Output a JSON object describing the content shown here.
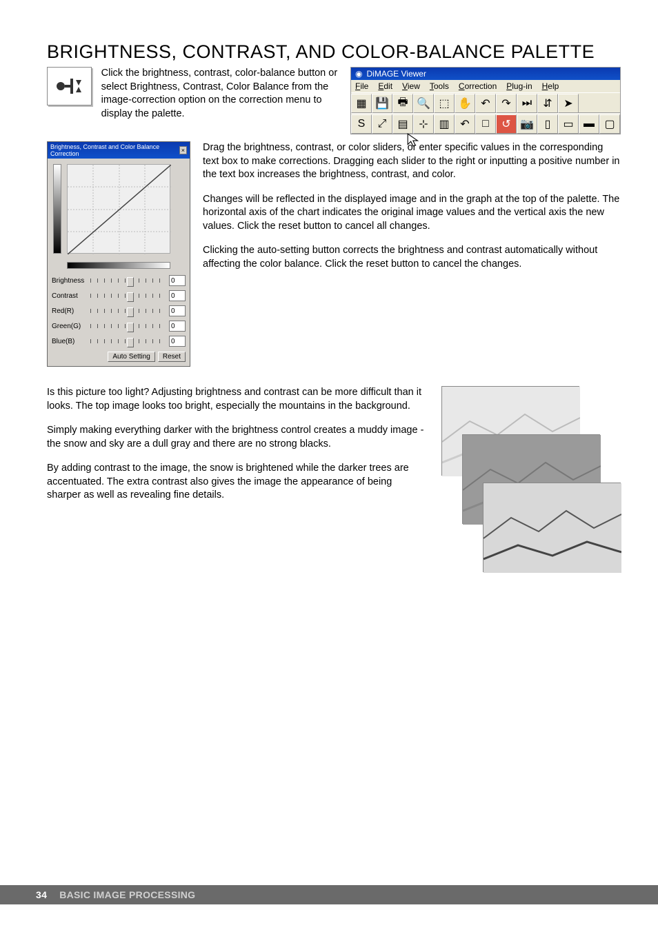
{
  "heading": "BRIGHTNESS, CONTRAST, AND COLOR-BALANCE PALETTE",
  "intro": "Click the brightness, contrast, color-balance button or select Brightness, Contrast, Color Balance from the image-correction option on the correction menu to display the palette.",
  "app": {
    "title": "DiMAGE Viewer",
    "menu": [
      "File",
      "Edit",
      "View",
      "Tools",
      "Correction",
      "Plug-in",
      "Help"
    ],
    "toolbar1_names": [
      "thumbnails-icon",
      "save-icon",
      "print-icon",
      "zoom-icon",
      "marquee-icon",
      "hand-icon",
      "rotate-left-icon",
      "rotate-right-icon",
      "skip-icon",
      "flip-icon",
      "arrow-icon"
    ],
    "toolbar1_glyphs": [
      "▦",
      "💾",
      "🖶",
      "🔍",
      "⬚",
      "✋",
      "↶",
      "↷",
      "⏭",
      "⇵",
      "➤"
    ],
    "toolbar2_names": [
      "sharpen-icon",
      "curve-icon",
      "contrast-icon",
      "sliders-icon",
      "variations-icon",
      "undo-icon",
      "redo-icon",
      "snapshot-active-icon",
      "camera-icon",
      "compare-a-icon",
      "compare-b-icon",
      "film-icon",
      "monitor-icon"
    ],
    "toolbar2_glyphs": [
      "S",
      "⤢",
      "▤",
      "⊹",
      "▥",
      "↶",
      "□",
      "↺",
      "📷",
      "▯",
      "▭",
      "▬",
      "▢"
    ]
  },
  "palette": {
    "title": "Brightness, Contrast and Color Balance Correction",
    "sliders": [
      {
        "label": "Brightness",
        "value": "0"
      },
      {
        "label": "Contrast",
        "value": "0"
      },
      {
        "label": "Red(R)",
        "value": "0"
      },
      {
        "label": "Green(G)",
        "value": "0"
      },
      {
        "label": "Blue(B)",
        "value": "0"
      }
    ],
    "auto": "Auto Setting",
    "reset": "Reset"
  },
  "body1": "Drag the brightness, contrast, or color sliders, or enter specific values in the corresponding text box to make corrections. Dragging each slider to the right or inputting a positive number in the text box increases the brightness, contrast, and color.",
  "body2": "Changes will be reflected in the displayed image and in the graph at the top of the palette. The horizontal axis of the chart indicates the original image values and the vertical axis the new values. Click the reset button to cancel all changes.",
  "body3": "Clicking the auto-setting button corrects the brightness and contrast automatically without affecting the color balance. Click the reset button to cancel the changes.",
  "lower1": "Is this picture too light? Adjusting brightness and contrast can be more difficult than it looks. The top image looks too bright, especially the mountains in the background.",
  "lower2": "Simply making everything darker with the brightness control creates a muddy image - the snow and sky are a dull gray and there are no strong blacks.",
  "lower3": "By adding contrast to the image, the snow is brightened while the darker trees are accentuated. The extra contrast also gives the image the appearance of being sharper as well as revealing fine details.",
  "footer": {
    "page": "34",
    "section": "BASIC IMAGE PROCESSING"
  }
}
